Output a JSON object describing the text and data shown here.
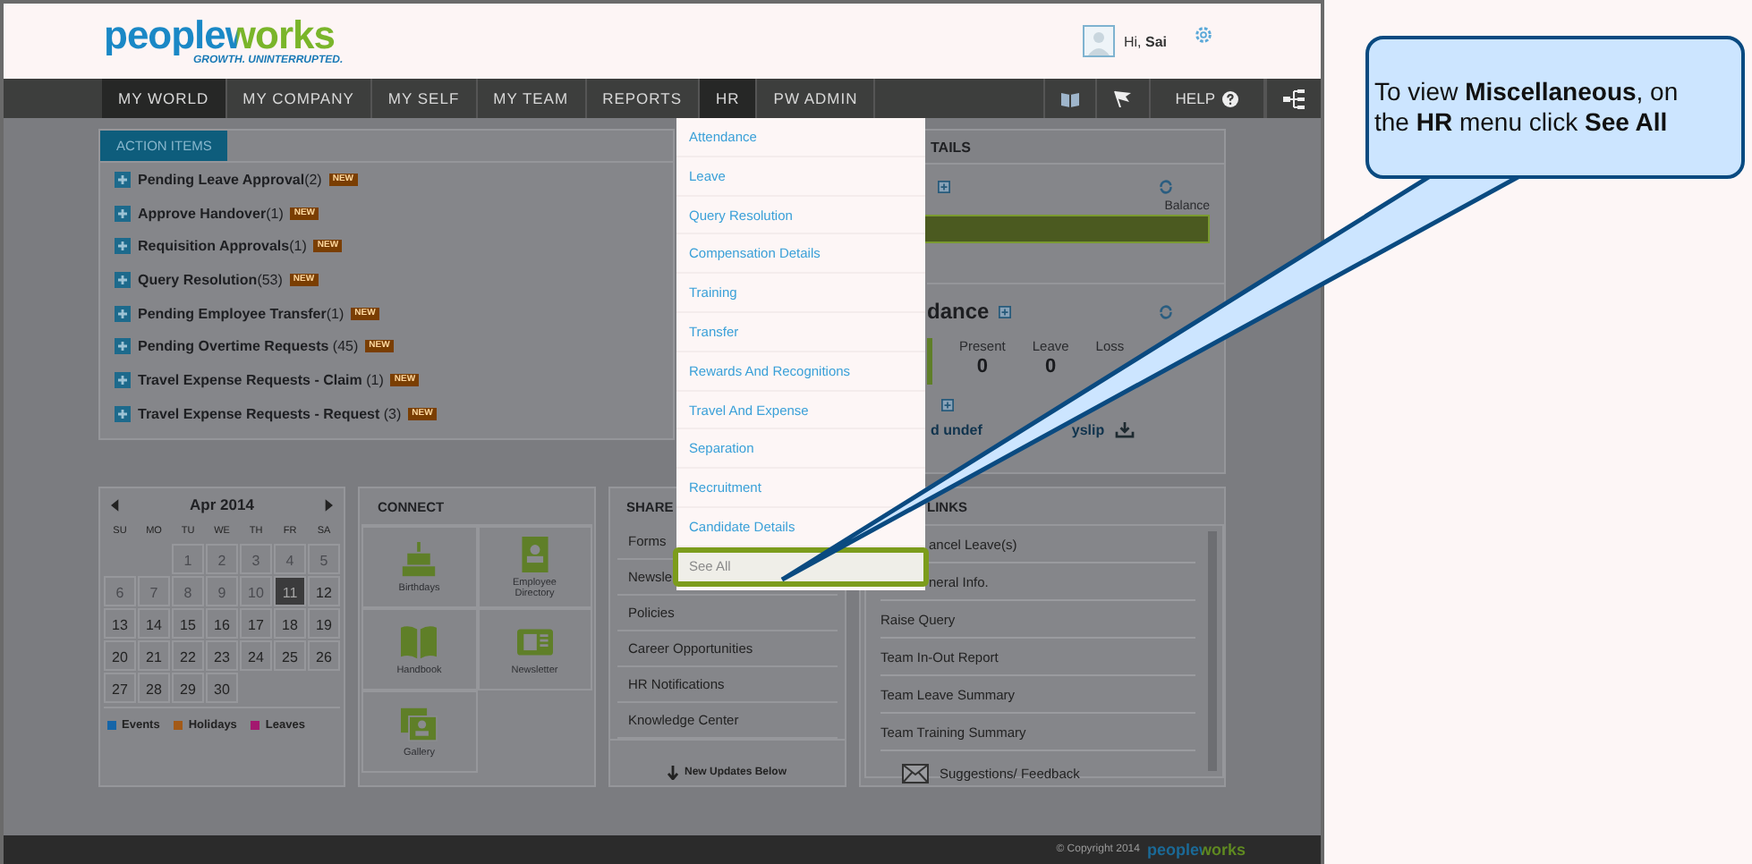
{
  "header": {
    "logo": "peopleworks",
    "tagline": "GROWTH. UNINTERRUPTED.",
    "greeting": "Hi, **Sai**"
  },
  "nav": {
    "items": [
      {
        "label": "MY WORLD",
        "selected": true,
        "open": false
      },
      {
        "label": "MY COMPANY",
        "selected": false,
        "open": false
      },
      {
        "label": "MY SELF",
        "selected": false,
        "open": false
      },
      {
        "label": "MY TEAM",
        "selected": false,
        "open": false
      },
      {
        "label": "REPORTS",
        "selected": false,
        "open": false
      },
      {
        "label": "HR",
        "selected": false,
        "open": true
      },
      {
        "label": "PW ADMIN",
        "selected": false,
        "open": false
      }
    ],
    "help": "HELP"
  },
  "hr_menu": {
    "items": [
      {
        "label": "Attendance",
        "highlighted": false
      },
      {
        "label": "Leave",
        "highlighted": false
      },
      {
        "label": "Query Resolution",
        "highlighted": false
      },
      {
        "label": "Compensation Details",
        "highlighted": false
      },
      {
        "label": "Training",
        "highlighted": false
      },
      {
        "label": "Transfer",
        "highlighted": false
      },
      {
        "label": "Rewards And Recognitions",
        "highlighted": false
      },
      {
        "label": "Travel And Expense",
        "highlighted": false
      },
      {
        "label": "Separation",
        "highlighted": false
      },
      {
        "label": "Recruitment",
        "highlighted": false
      },
      {
        "label": "Candidate Details",
        "highlighted": false
      },
      {
        "label": "See All",
        "highlighted": true
      }
    ]
  },
  "action_items": {
    "tab": "ACTION ITEMS",
    "items": [
      {
        "label": "**Pending Leave Approval**(2)",
        "badge": "NEW"
      },
      {
        "label": "**Approve Handover**(1)",
        "badge": "NEW"
      },
      {
        "label": "**Requisition Approvals**(1)",
        "badge": "NEW"
      },
      {
        "label": "**Query Resolution**(53)",
        "badge": "NEW"
      },
      {
        "label": "**Pending Employee Transfer**(1)",
        "badge": "NEW"
      },
      {
        "label": "**Pending Overtime Requests** (45)",
        "badge": "NEW"
      },
      {
        "label": "**Travel Expense Requests - Claim** (1)",
        "badge": "NEW"
      },
      {
        "label": "**Travel Expense Requests - Request** (3)",
        "badge": "NEW"
      }
    ]
  },
  "details": {
    "heading": "TAILS",
    "balance_label": "Balance",
    "attendance_heading": "dance",
    "stats": [
      {
        "label": "Present",
        "value": "0"
      },
      {
        "label": "Leave",
        "value": "0"
      },
      {
        "label": "Loss"
      }
    ],
    "payslip_start": "d undef",
    "payslip_end": "yslip"
  },
  "calendar": {
    "month": "Apr 2014",
    "weekdays": [
      "SU",
      "MO",
      "TU",
      "WE",
      "TH",
      "FR",
      "SA"
    ],
    "weeks": [
      [
        {
          "kind": "empty"
        },
        {
          "kind": "empty"
        },
        {
          "kind": "day",
          "day": "1",
          "muted": true,
          "selected": false
        },
        {
          "kind": "day",
          "day": "2",
          "muted": true,
          "selected": false
        },
        {
          "kind": "day",
          "day": "3",
          "muted": true,
          "selected": false
        },
        {
          "kind": "day",
          "day": "4",
          "muted": true,
          "selected": false
        },
        {
          "kind": "day",
          "day": "5",
          "muted": true,
          "selected": false
        }
      ],
      [
        {
          "kind": "day",
          "day": "6",
          "muted": true,
          "selected": false
        },
        {
          "kind": "day",
          "day": "7",
          "muted": true,
          "selected": false
        },
        {
          "kind": "day",
          "day": "8",
          "muted": true,
          "selected": false
        },
        {
          "kind": "day",
          "day": "9",
          "muted": true,
          "selected": false
        },
        {
          "kind": "day",
          "day": "10",
          "muted": true,
          "selected": false
        },
        {
          "kind": "day",
          "day": "11",
          "muted": false,
          "selected": true
        },
        {
          "kind": "day",
          "day": "12",
          "muted": false,
          "selected": false
        }
      ],
      [
        {
          "kind": "day",
          "day": "13",
          "muted": false,
          "selected": false
        },
        {
          "kind": "day",
          "day": "14",
          "muted": false,
          "selected": false
        },
        {
          "kind": "day",
          "day": "15",
          "muted": false,
          "selected": false
        },
        {
          "kind": "day",
          "day": "16",
          "muted": false,
          "selected": false
        },
        {
          "kind": "day",
          "day": "17",
          "muted": false,
          "selected": false
        },
        {
          "kind": "day",
          "day": "18",
          "muted": false,
          "selected": false
        },
        {
          "kind": "day",
          "day": "19",
          "muted": false,
          "selected": false
        }
      ],
      [
        {
          "kind": "day",
          "day": "20",
          "muted": false,
          "selected": false
        },
        {
          "kind": "day",
          "day": "21",
          "muted": false,
          "selected": false
        },
        {
          "kind": "day",
          "day": "22",
          "muted": false,
          "selected": false
        },
        {
          "kind": "day",
          "day": "23",
          "muted": false,
          "selected": false
        },
        {
          "kind": "day",
          "day": "24",
          "muted": false,
          "selected": false
        },
        {
          "kind": "day",
          "day": "25",
          "muted": false,
          "selected": false
        },
        {
          "kind": "day",
          "day": "26",
          "muted": false,
          "selected": false
        }
      ],
      [
        {
          "kind": "day",
          "day": "27",
          "muted": false,
          "selected": false
        },
        {
          "kind": "day",
          "day": "28",
          "muted": false,
          "selected": false
        },
        {
          "kind": "day",
          "day": "29",
          "muted": false,
          "selected": false
        },
        {
          "kind": "day",
          "day": "30",
          "muted": false,
          "selected": false
        },
        {
          "kind": "empty"
        },
        {
          "kind": "empty"
        },
        {
          "kind": "empty"
        }
      ]
    ],
    "legend": [
      {
        "label": "Events",
        "color": "#1565a8"
      },
      {
        "label": "Holidays",
        "color": "#a35a17"
      },
      {
        "label": "Leaves",
        "color": "#a3186f"
      }
    ]
  },
  "connect": {
    "title": "CONNECT",
    "tiles": [
      {
        "label": "Birthdays",
        "kind": "cake"
      },
      {
        "label": "Employee Directory",
        "kind": "directory"
      },
      {
        "label": "Handbook",
        "kind": "book"
      },
      {
        "label": "Newsletter",
        "kind": "newspaper"
      },
      {
        "label": "Gallery",
        "kind": "gallery"
      }
    ]
  },
  "shared": {
    "title": "SHARE",
    "items": [
      "Forms",
      "Newsle",
      "Policies",
      "Career Opportunities",
      "HR Notifications",
      "Knowledge Center"
    ],
    "footer": "New Updates Below"
  },
  "links": {
    "title": "LINKS",
    "items": [
      "ancel Leave(s)",
      "neral Info.",
      "Raise Query",
      "Team In-Out Report",
      "Team Leave Summary",
      "Team Training Summary"
    ],
    "feedback": "Suggestions/ Feedback"
  },
  "footer": {
    "copyright": "© Copyright 2014",
    "logo": "peopleworks"
  },
  "callout": {
    "text": "To view **Miscellaneous**, on the **HR** menu click **See All**"
  }
}
